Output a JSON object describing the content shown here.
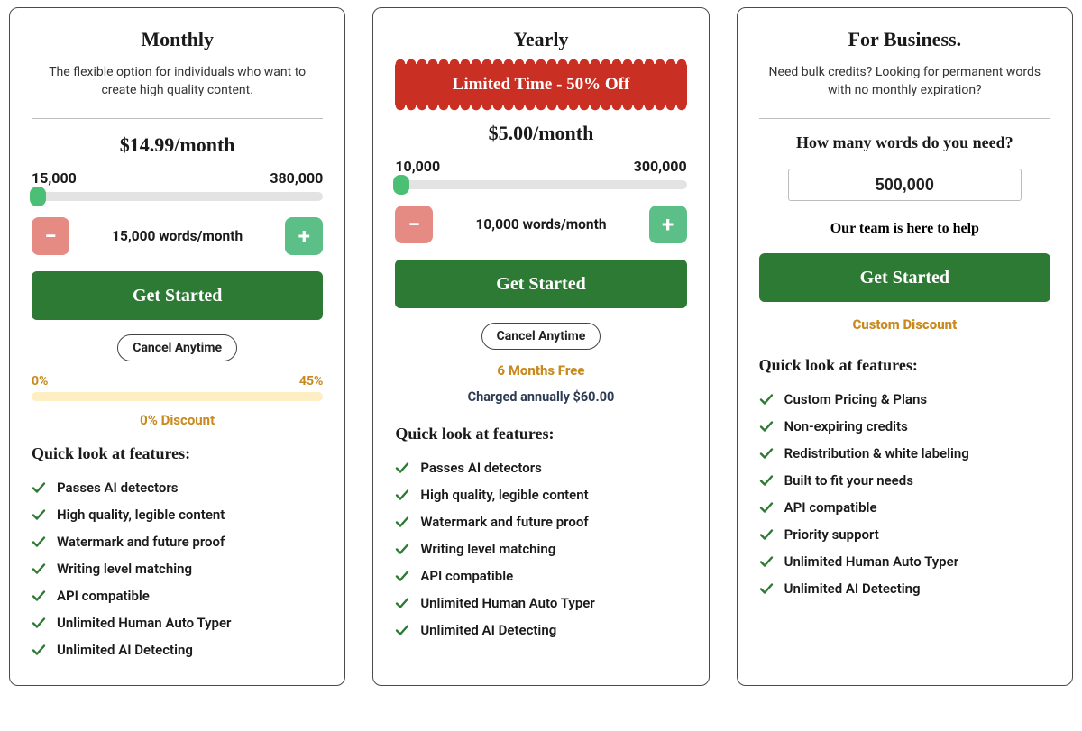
{
  "common": {
    "cta_label": "Get Started",
    "features_title": "Quick look at features:",
    "cancel_label": "Cancel Anytime"
  },
  "standard_features": [
    "Passes AI detectors",
    "High quality, legible content",
    "Watermark and future proof",
    "Writing level matching",
    "API compatible",
    "Unlimited Human Auto Typer",
    "Unlimited AI Detecting"
  ],
  "monthly": {
    "title": "Monthly",
    "subtitle": "The flexible option for individuals who want to create high quality content.",
    "price": "$14.99/month",
    "range_min_label": "15,000",
    "range_max_label": "380,000",
    "stepper_label": "15,000 words/month",
    "discount_min": "0%",
    "discount_max": "45%",
    "discount_text": "0% Discount"
  },
  "yearly": {
    "title": "Yearly",
    "promo": "Limited Time - 50% Off",
    "price": "$5.00/month",
    "range_min_label": "10,000",
    "range_max_label": "300,000",
    "stepper_label": "10,000 words/month",
    "bonus_text": "6 Months Free",
    "charged_text": "Charged annually $60.00"
  },
  "business": {
    "title": "For Business.",
    "subtitle": "Need bulk credits? Looking for permanent words with no monthly expiration?",
    "question": "How many words do you need?",
    "input_value": "500,000",
    "help_text": "Our team is here to help",
    "custom_discount": "Custom Discount",
    "features": [
      "Custom Pricing & Plans",
      "Non-expiring credits",
      "Redistribution & white labeling",
      "Built to fit your needs",
      "API compatible",
      "Priority support",
      "Unlimited Human Auto Typer",
      "Unlimited AI Detecting"
    ]
  }
}
